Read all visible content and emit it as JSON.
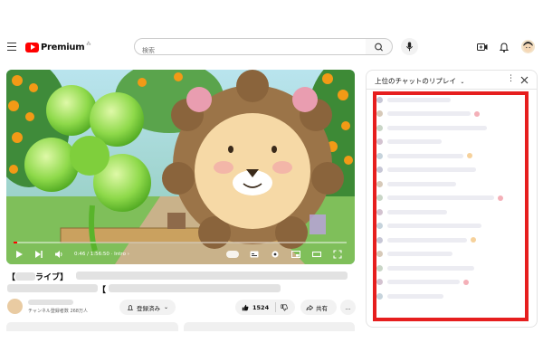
{
  "header": {
    "logo_text": "Premium",
    "search_placeholder": "検索",
    "icons": [
      "menu-icon",
      "search-icon",
      "mic-icon",
      "create-icon",
      "bell-icon",
      "avatar"
    ]
  },
  "player": {
    "time_current": "0:46",
    "time_total": "1:56:50",
    "chapter": "Intro",
    "progress_fraction": 0.01
  },
  "video": {
    "title_line1_prefix": "【",
    "title_line1_visible": "ライブ】",
    "title_line2_prefix": "【",
    "subscribers": "チャンネル登録者数 268万人",
    "subscribed_label": "登録済み",
    "like_count": "1524",
    "share_label": "共有"
  },
  "chat": {
    "title": "上位のチャットのリプレイ"
  },
  "colors": {
    "accent_red": "#ff0000",
    "highlight_box": "#e61e1e"
  }
}
